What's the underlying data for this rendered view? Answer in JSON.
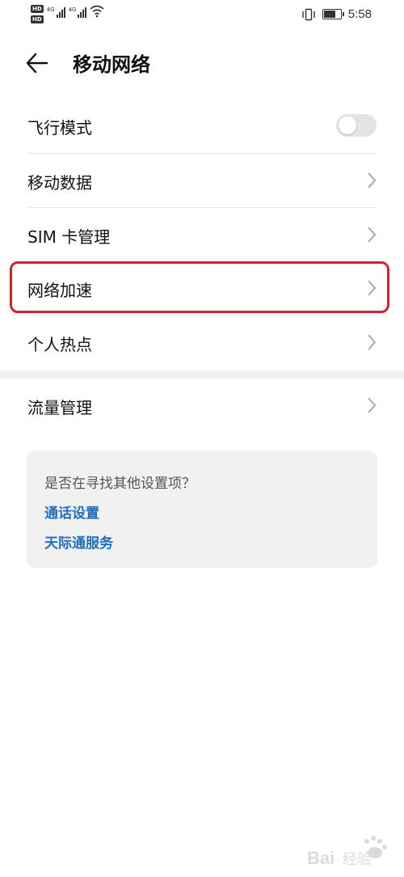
{
  "status_bar": {
    "hd1": "HD",
    "hd2": "HD",
    "net1": "4G",
    "net2": "4G",
    "time": "5:58",
    "battery_level": 0.75,
    "icons": [
      "hd-icon",
      "signal-icon",
      "signal-icon",
      "wifi-icon",
      "vibrate-icon",
      "battery-icon"
    ]
  },
  "header": {
    "back_icon": "arrow-left-icon",
    "title": "移动网络"
  },
  "list": {
    "airplane_mode": {
      "label": "飞行模式",
      "enabled": false
    },
    "mobile_data": {
      "label": "移动数据"
    },
    "sim_management": {
      "label": "SIM 卡管理"
    },
    "network_acceleration": {
      "label": "网络加速",
      "highlighted": true
    },
    "personal_hotspot": {
      "label": "个人热点"
    },
    "data_usage": {
      "label": "流量管理"
    }
  },
  "suggestions": {
    "question": "是否在寻找其他设置项？",
    "links": [
      "通话设置",
      "天际通服务"
    ]
  },
  "watermark": {
    "text": "Bai经验"
  },
  "colors": {
    "highlight": "#d0232d",
    "link": "#1f6fbf",
    "card_bg": "#f1f1f1",
    "toggle_off": "#e4e4e4"
  }
}
